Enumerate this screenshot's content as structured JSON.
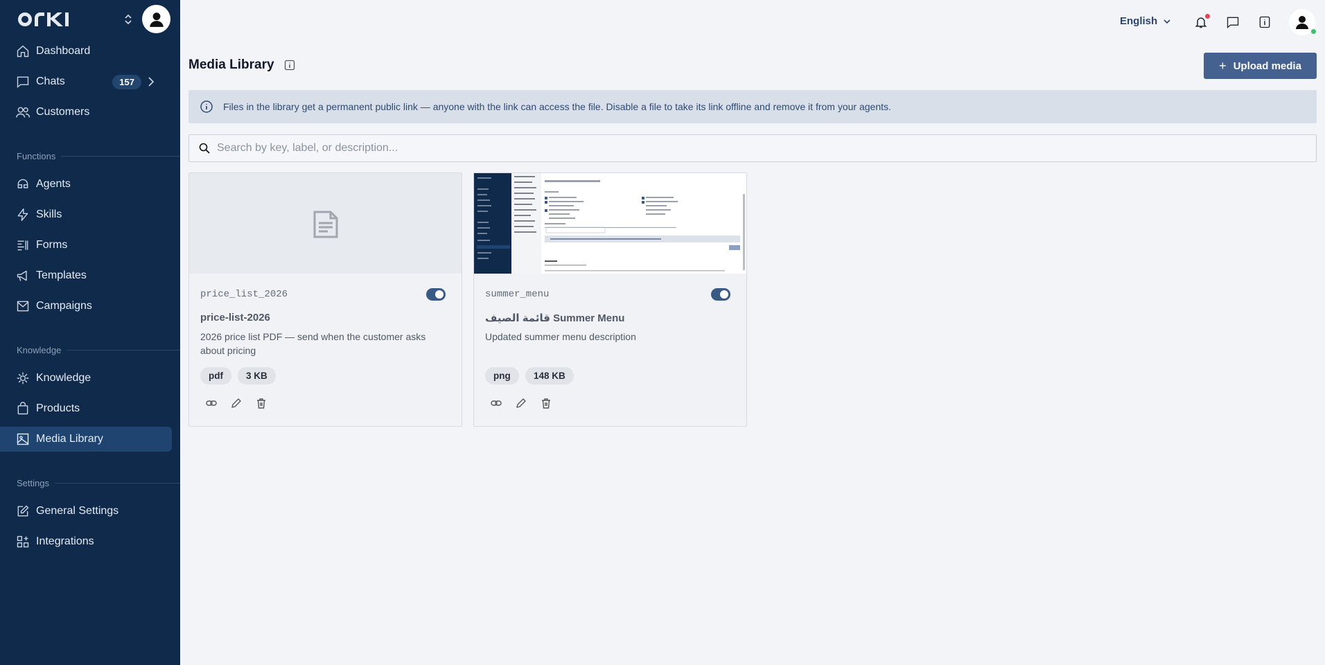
{
  "brand": {
    "logo_text": "ORKI"
  },
  "sidebar": {
    "items": [
      {
        "label": "Dashboard"
      },
      {
        "label": "Chats",
        "badge": "157"
      },
      {
        "label": "Customers"
      },
      {
        "label": "Agents"
      },
      {
        "label": "Skills"
      },
      {
        "label": "Forms"
      },
      {
        "label": "Templates"
      },
      {
        "label": "Campaigns"
      },
      {
        "label": "Knowledge"
      },
      {
        "label": "Products"
      },
      {
        "label": "Media Library"
      },
      {
        "label": "General Settings"
      },
      {
        "label": "Integrations"
      }
    ],
    "sections": {
      "functions": "Functions",
      "knowledge": "Knowledge",
      "settings": "Settings"
    },
    "active_item": "Media Library"
  },
  "topbar": {
    "language": "English"
  },
  "page": {
    "title": "Media Library",
    "upload_button": "Upload media",
    "banner_text": "Files in the library get a permanent public link — anyone with the link can access the file. Disable a file to take its link offline and remove it from your agents.",
    "search_placeholder": "Search by key, label, or description..."
  },
  "media": [
    {
      "key": "price_list_2026",
      "label": "price-list-2026",
      "description": "2026 price list PDF — send when the customer asks about pricing",
      "type": "pdf",
      "size": "3 KB",
      "enabled": true
    },
    {
      "key": "summer_menu",
      "label": "قائمة الصيف Summer Menu",
      "description": "Updated summer menu description",
      "type": "png",
      "size": "148 KB",
      "enabled": true
    }
  ],
  "colors": {
    "sidebar_bg": "#0f2a4a",
    "accent": "#44618f",
    "active_nav": "#1f4470",
    "toggle_on": "#3a5a86",
    "notification": "#e8455a",
    "online": "#3ac26a"
  }
}
